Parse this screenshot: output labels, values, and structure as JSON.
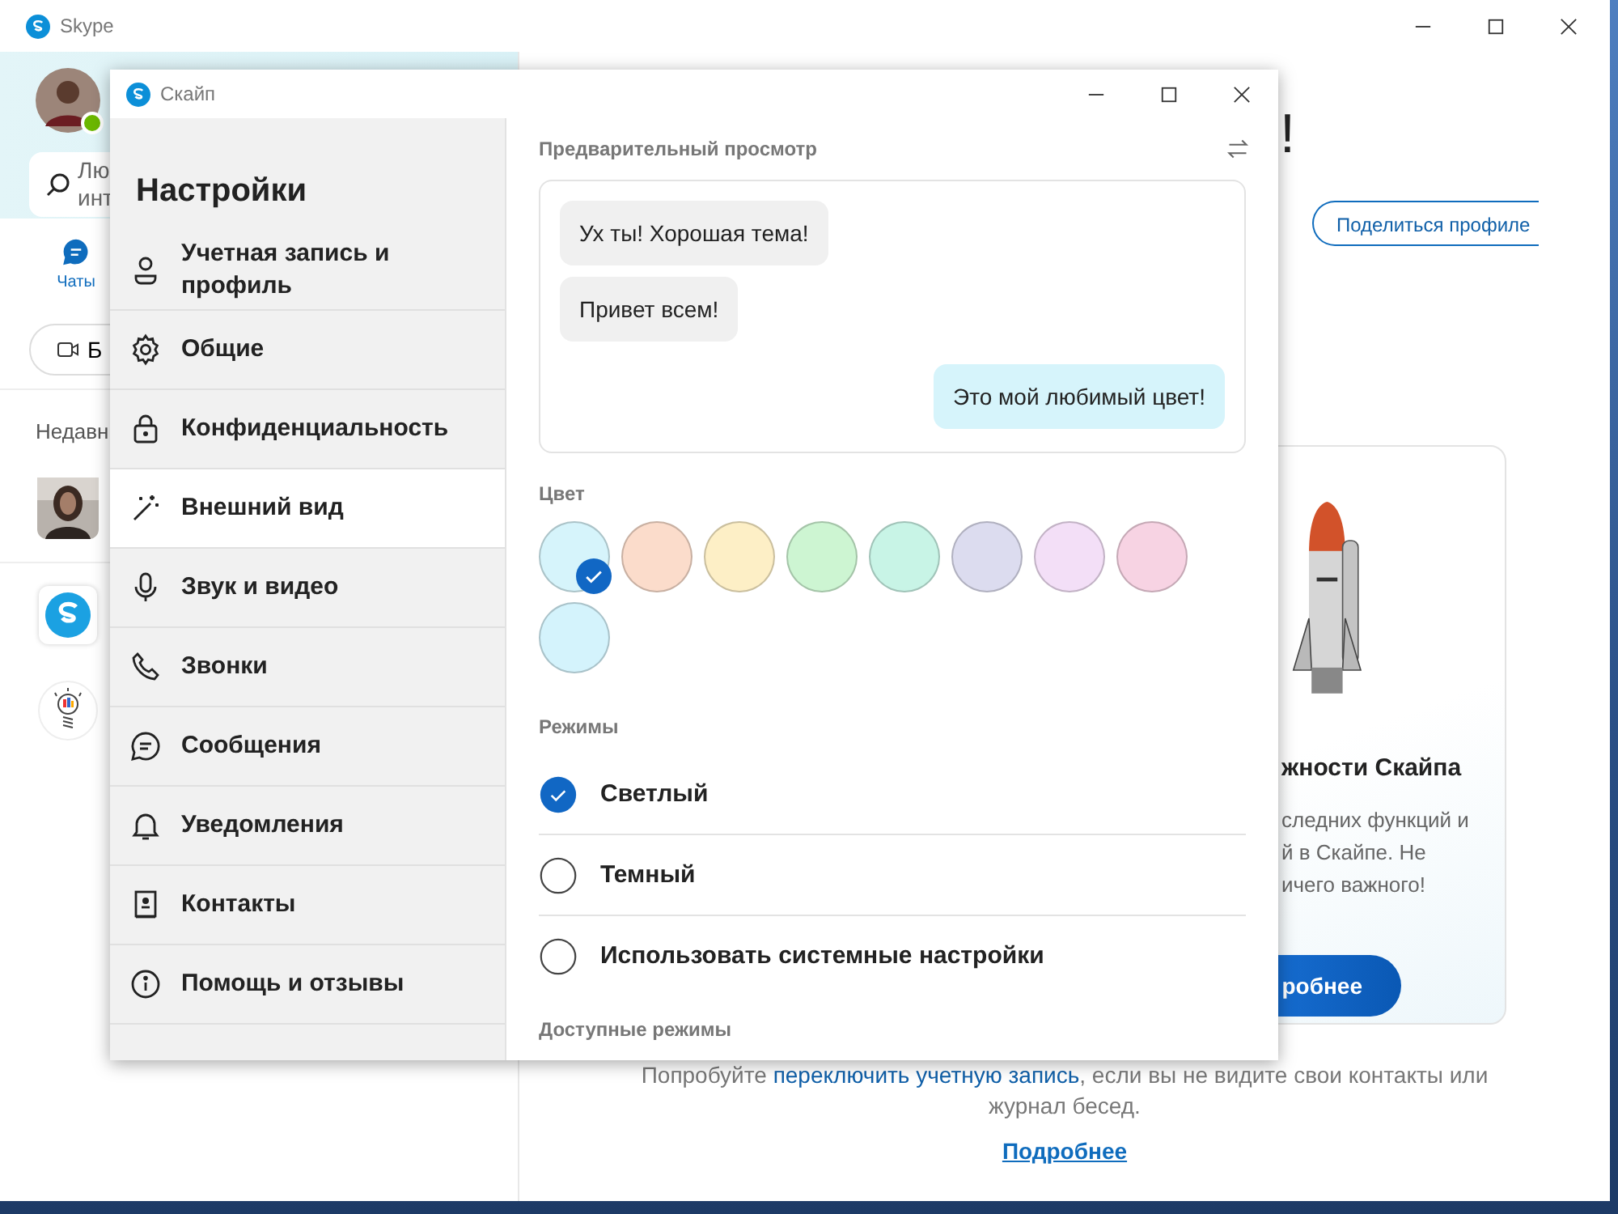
{
  "main_window": {
    "title": "Skype",
    "search_placeholder_lines": [
      "Лю",
      "инт"
    ],
    "nav_tab": {
      "label": "Чаты",
      "selected": true
    },
    "meet_button": "Б",
    "recent_heading": "Недавн",
    "greeting_tail": "!",
    "share_button": "Поделиться профиле",
    "card": {
      "title": "жности Скайпа",
      "lines": [
        "следних функций и",
        "й в Скайпе. Не",
        "ичего важного!"
      ],
      "button": "робнее"
    },
    "footer": {
      "before": "Попробуйте ",
      "link": "переключить учетную запись",
      "after": ", если вы не видите свои контакты или журнал бесед.",
      "more_link": "Подробнее"
    }
  },
  "settings_window": {
    "title": "Скайп",
    "heading": "Настройки",
    "items": [
      {
        "kind": "account",
        "label": "Учетная запись и профиль",
        "selected": false
      },
      {
        "kind": "general",
        "label": "Общие",
        "selected": false
      },
      {
        "kind": "privacy",
        "label": "Конфиденциальность",
        "selected": false
      },
      {
        "kind": "appearance",
        "label": "Внешний вид",
        "selected": true
      },
      {
        "kind": "audio",
        "label": "Звук и видео",
        "selected": false
      },
      {
        "kind": "calls",
        "label": "Звонки",
        "selected": false
      },
      {
        "kind": "messages",
        "label": "Сообщения",
        "selected": false
      },
      {
        "kind": "notifications",
        "label": "Уведомления",
        "selected": false
      },
      {
        "kind": "contacts",
        "label": "Контакты",
        "selected": false
      },
      {
        "kind": "help",
        "label": "Помощь и отзывы",
        "selected": false
      }
    ],
    "preview_label": "Предварительный просмотр",
    "preview_messages": [
      {
        "kind": "incoming",
        "text": "Ух ты! Хорошая тема!"
      },
      {
        "kind": "incoming",
        "text": "Привет всем!"
      },
      {
        "kind": "outgoing",
        "text": "Это мой любимый цвет!"
      }
    ],
    "color_label": "Цвет",
    "colors": [
      {
        "color": "#d6f4fb",
        "selected": true
      },
      {
        "color": "#fbdccb",
        "selected": false
      },
      {
        "color": "#fdefc6",
        "selected": false
      },
      {
        "color": "#cdf5d2",
        "selected": false
      },
      {
        "color": "#c8f4e6",
        "selected": false
      },
      {
        "color": "#dcdcef",
        "selected": false
      },
      {
        "color": "#f3dff7",
        "selected": false
      },
      {
        "color": "#f7d3e3",
        "selected": false
      },
      {
        "color": "#d4f3fc",
        "selected": false
      }
    ],
    "modes_label": "Режимы",
    "modes": [
      {
        "label": "Светлый",
        "selected": true
      },
      {
        "label": "Темный",
        "selected": false
      },
      {
        "label": "Использовать системные настройки",
        "selected": false
      }
    ],
    "available_modes_label": "Доступные режимы"
  }
}
